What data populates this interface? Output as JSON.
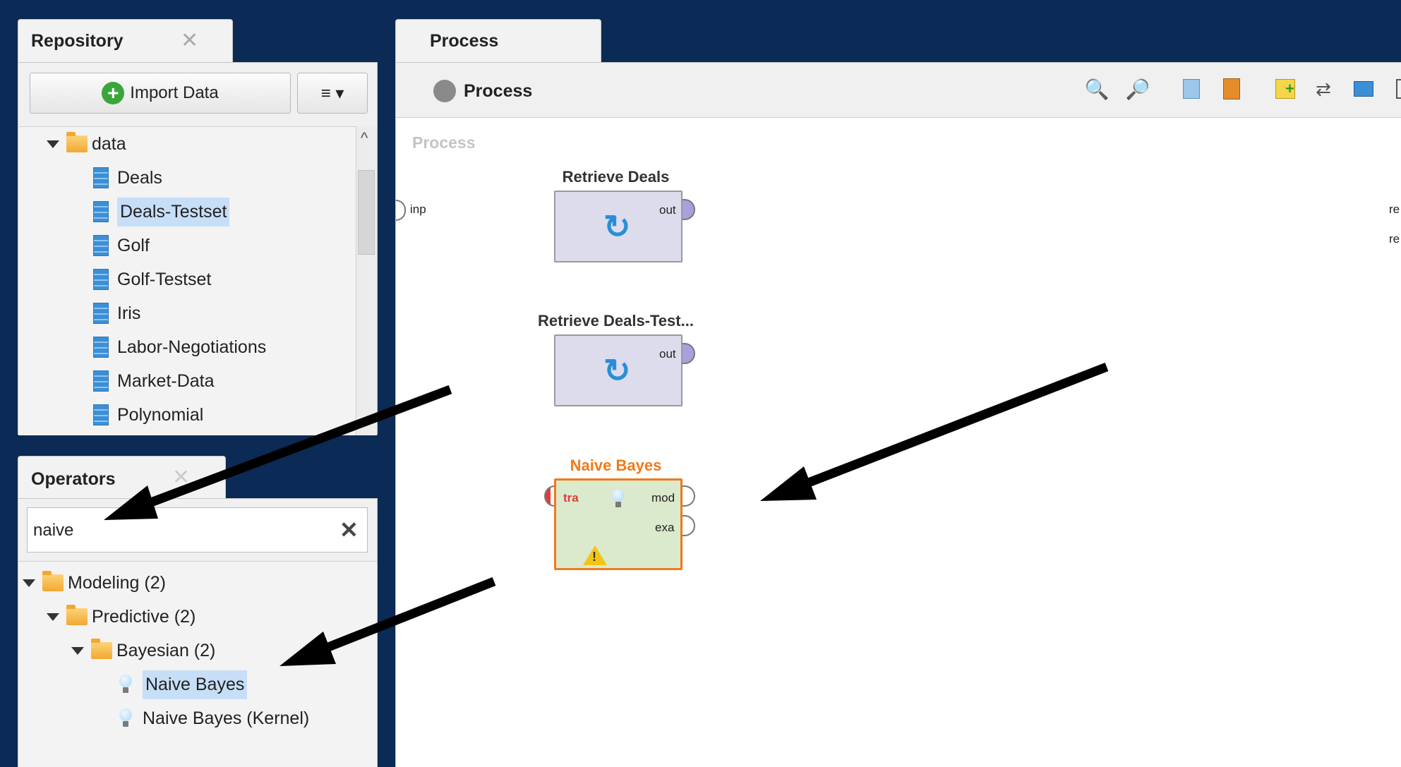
{
  "repository": {
    "tab_label": "Repository",
    "import_button": "Import Data",
    "menu_button": "≡ ▾",
    "folder": "data",
    "items": [
      "Deals",
      "Deals-Testset",
      "Golf",
      "Golf-Testset",
      "Iris",
      "Labor-Negotiations",
      "Market-Data",
      "Polynomial"
    ],
    "selected_item": "Deals-Testset"
  },
  "operators": {
    "tab_label": "Operators",
    "search_value": "naive",
    "tree": {
      "modeling": "Modeling (2)",
      "predictive": "Predictive (2)",
      "bayesian": "Bayesian (2)",
      "naive_bayes": "Naive Bayes",
      "naive_bayes_kernel": "Naive Bayes (Kernel)"
    }
  },
  "process": {
    "tab_label": "Process",
    "toolbar_title": "Process",
    "canvas_label": "Process",
    "input_port": "inp",
    "result_port_1": "re",
    "result_port_2": "re",
    "operators": [
      {
        "name": "Retrieve Deals",
        "out": "out"
      },
      {
        "name": "Retrieve Deals-Test...",
        "out": "out"
      },
      {
        "name": "Naive Bayes",
        "in": "tra",
        "out1": "mod",
        "out2": "exa"
      }
    ]
  },
  "colors": {
    "accent_orange": "#f07a1a",
    "selection": "#c7def7",
    "background": "#0b2a55"
  }
}
